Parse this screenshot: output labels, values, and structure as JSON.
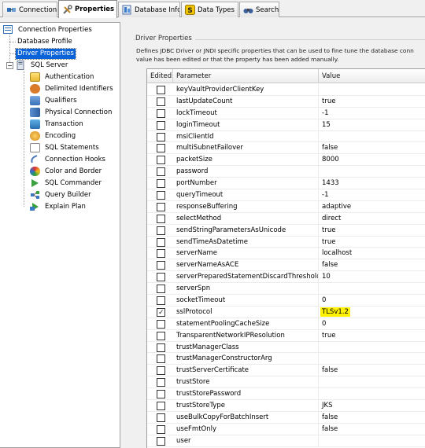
{
  "tabs": [
    {
      "label": "Connection",
      "icon": "connection-icon",
      "active": false
    },
    {
      "label": "Properties",
      "icon": "tools-icon",
      "active": true
    },
    {
      "label": "Database Info",
      "icon": "database-info-icon",
      "active": false
    },
    {
      "label": "Data Types",
      "icon": "data-types-icon",
      "active": false
    },
    {
      "label": "Search",
      "icon": "binoculars-icon",
      "active": false
    }
  ],
  "tree": {
    "items": [
      {
        "label": "Connection Properties",
        "icon": "properties-icon",
        "expanded": true
      },
      {
        "label": "Database Profile"
      },
      {
        "label": "Driver Properties",
        "selected": true
      },
      {
        "label": "SQL Server",
        "icon": "server-icon",
        "expanded": true
      },
      {
        "label": "Authentication",
        "icon": "folder-icon"
      },
      {
        "label": "Delimited Identifiers",
        "icon": "delimited-identifiers-icon"
      },
      {
        "label": "Qualifiers",
        "icon": "qualifiers-icon"
      },
      {
        "label": "Physical Connection",
        "icon": "physical-connection-icon"
      },
      {
        "label": "Transaction",
        "icon": "transaction-icon"
      },
      {
        "label": "Encoding",
        "icon": "encoding-icon"
      },
      {
        "label": "SQL Statements",
        "icon": "sql-statements-icon"
      },
      {
        "label": "Connection Hooks",
        "icon": "connection-hooks-icon"
      },
      {
        "label": "Color and Border",
        "icon": "color-border-icon"
      },
      {
        "label": "SQL Commander",
        "icon": "sql-commander-icon"
      },
      {
        "label": "Query Builder",
        "icon": "query-builder-icon"
      },
      {
        "label": "Explain Plan",
        "icon": "explain-plan-icon"
      }
    ]
  },
  "driver_properties": {
    "group_title": "Driver Properties",
    "description_line1": "Defines JDBC Driver or JNDI specific properties that can be used to fine tune the database conn",
    "description_line2": "value has been edited or that the property has been added manually.",
    "columns": {
      "edited": "Edited",
      "parameter": "Parameter",
      "value": "Value"
    },
    "rows": [
      {
        "parameter": "keyVaultProviderClientKey",
        "value": "",
        "edited": false
      },
      {
        "parameter": "lastUpdateCount",
        "value": "true",
        "edited": false
      },
      {
        "parameter": "lockTimeout",
        "value": "-1",
        "edited": false
      },
      {
        "parameter": "loginTimeout",
        "value": "15",
        "edited": false
      },
      {
        "parameter": "msiClientId",
        "value": "",
        "edited": false
      },
      {
        "parameter": "multiSubnetFailover",
        "value": "false",
        "edited": false
      },
      {
        "parameter": "packetSize",
        "value": "8000",
        "edited": false
      },
      {
        "parameter": "password",
        "value": "",
        "edited": false
      },
      {
        "parameter": "portNumber",
        "value": "1433",
        "edited": false
      },
      {
        "parameter": "queryTimeout",
        "value": "-1",
        "edited": false
      },
      {
        "parameter": "responseBuffering",
        "value": "adaptive",
        "edited": false
      },
      {
        "parameter": "selectMethod",
        "value": "direct",
        "edited": false
      },
      {
        "parameter": "sendStringParametersAsUnicode",
        "value": "true",
        "edited": false
      },
      {
        "parameter": "sendTimeAsDatetime",
        "value": "true",
        "edited": false
      },
      {
        "parameter": "serverName",
        "value": "localhost",
        "edited": false
      },
      {
        "parameter": "serverNameAsACE",
        "value": "false",
        "edited": false
      },
      {
        "parameter": "serverPreparedStatementDiscardThreshold",
        "value": "10",
        "edited": false
      },
      {
        "parameter": "serverSpn",
        "value": "",
        "edited": false
      },
      {
        "parameter": "socketTimeout",
        "value": "0",
        "edited": false
      },
      {
        "parameter": "sslProtocol",
        "value": "TLSv1.2",
        "edited": true,
        "highlight": true
      },
      {
        "parameter": "statementPoolingCacheSize",
        "value": "0",
        "edited": false
      },
      {
        "parameter": "TransparentNetworkIPResolution",
        "value": "true",
        "edited": false
      },
      {
        "parameter": "trustManagerClass",
        "value": "",
        "edited": false
      },
      {
        "parameter": "trustManagerConstructorArg",
        "value": "",
        "edited": false
      },
      {
        "parameter": "trustServerCertificate",
        "value": "false",
        "edited": false
      },
      {
        "parameter": "trustStore",
        "value": "",
        "edited": false
      },
      {
        "parameter": "trustStorePassword",
        "value": "",
        "edited": false
      },
      {
        "parameter": "trustStoreType",
        "value": "JKS",
        "edited": false
      },
      {
        "parameter": "useBulkCopyForBatchInsert",
        "value": "false",
        "edited": false
      },
      {
        "parameter": "useFmtOnly",
        "value": "false",
        "edited": false
      },
      {
        "parameter": "user",
        "value": "",
        "edited": false
      }
    ]
  },
  "colors": {
    "selection": "#0a64d8",
    "highlight": "#fff200"
  }
}
